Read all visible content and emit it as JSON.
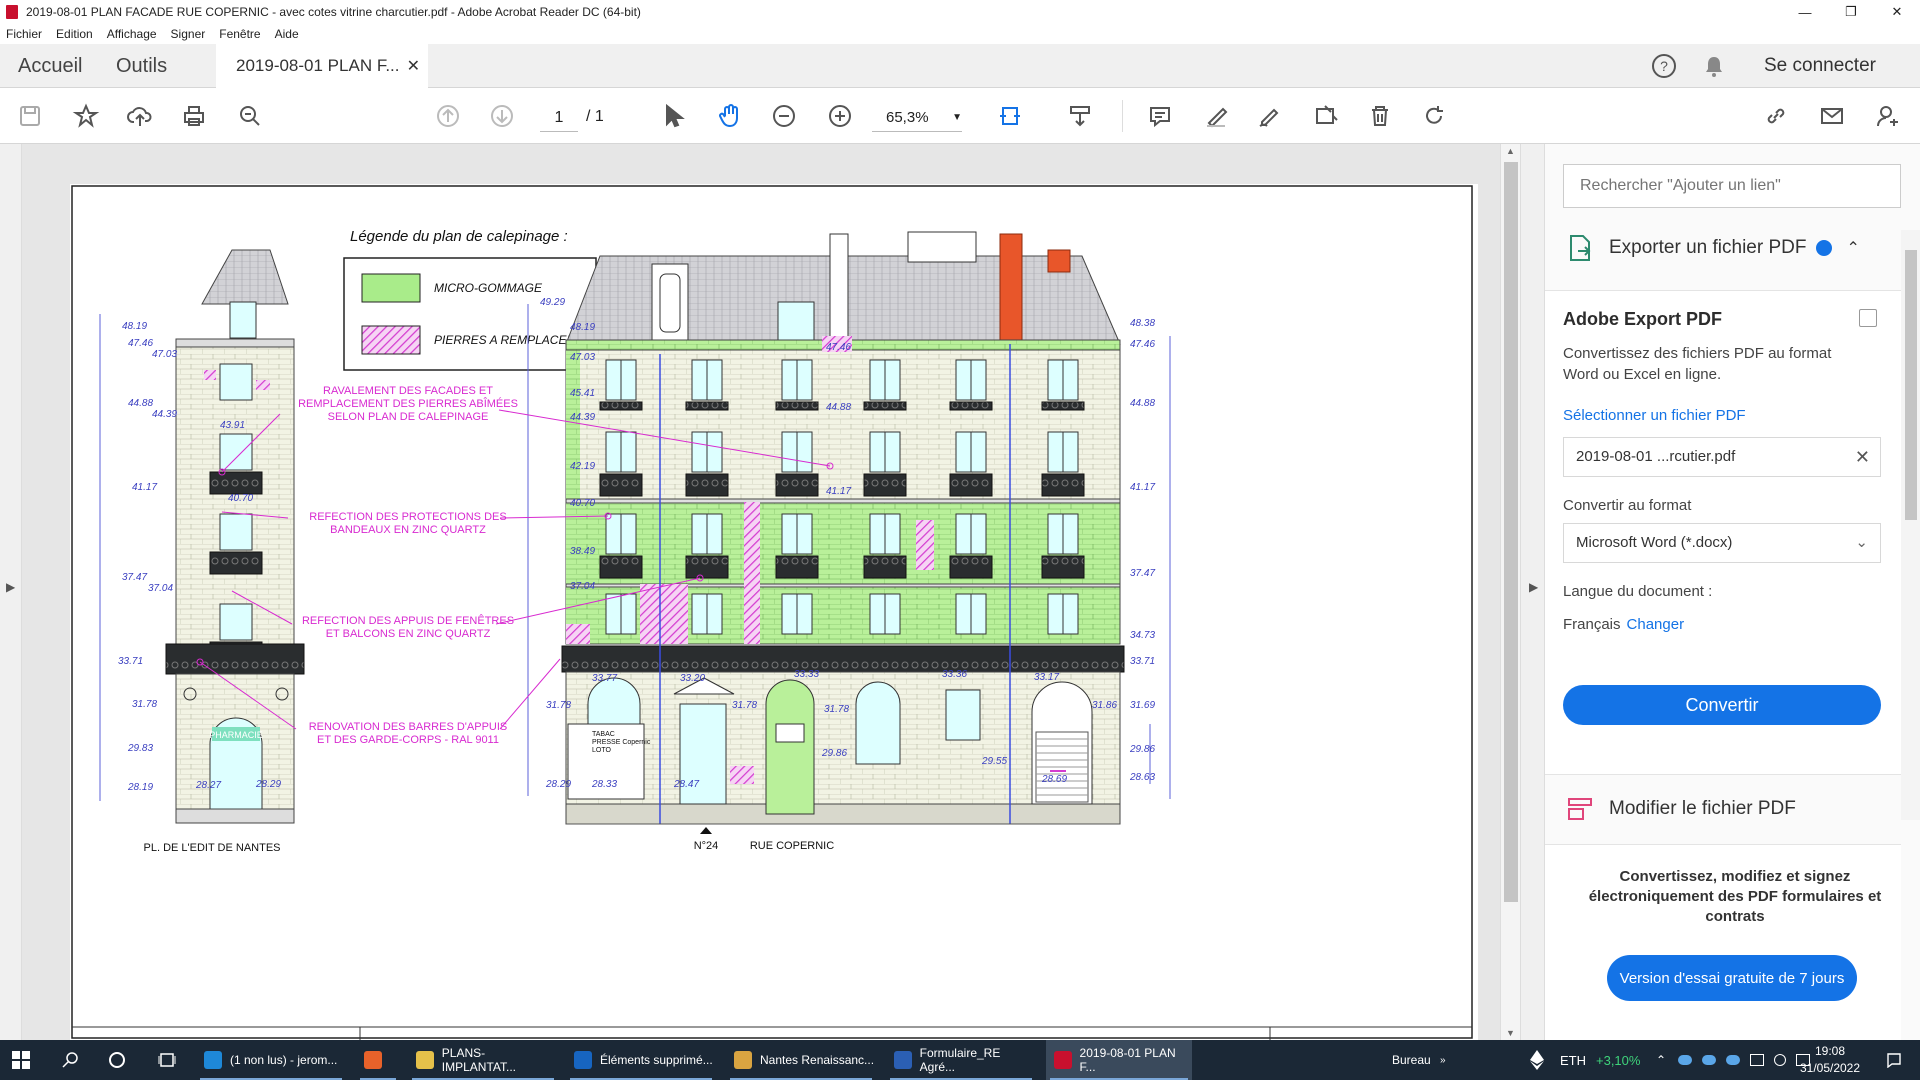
{
  "window": {
    "title": "2019-08-01 PLAN FACADE RUE COPERNIC - avec cotes vitrine charcutier.pdf - Adobe Acrobat Reader DC (64-bit)"
  },
  "menu": [
    "Fichier",
    "Edition",
    "Affichage",
    "Signer",
    "Fenêtre",
    "Aide"
  ],
  "tabs": {
    "home": "Accueil",
    "tools": "Outils",
    "doc": "2019-08-01 PLAN F...",
    "signin": "Se connecter"
  },
  "toolbar": {
    "page_current": "1",
    "page_total": "/ 1",
    "zoom": "65,3%"
  },
  "drawing": {
    "legend_title": "Légende du plan de calepinage :",
    "legend_items": [
      {
        "label": "MICRO-GOMMAGE",
        "color": "#a9ec8a"
      },
      {
        "label": "PIERRES A REMPLACER",
        "color": "#e47ae0"
      }
    ],
    "annotations": [
      "RAVALEMENT DES FACADES ET\nREMPLACEMENT DES PIERRES ABÎMÉES\nSELON PLAN DE CALEPINAGE",
      "REFECTION DES PROTECTIONS DES\nBANDEAUX EN ZINC QUARTZ",
      "REFECTION DES APPUIS DE FENÊTRES\nET BALCONS EN ZINC QUARTZ",
      "RENOVATION DES BARRES D'APPUIS\nET DES GARDE-CORPS - RAL 9011"
    ],
    "left_levels": [
      "48.19",
      "47.46",
      "47.03",
      "44.88",
      "44.39",
      "43.91",
      "41.17",
      "40.70",
      "37.47",
      "37.04",
      "33.71",
      "31.78",
      "29.83",
      "28.19",
      "28.27",
      "28.29"
    ],
    "right_levels": [
      "48.38",
      "47.46",
      "44.88",
      "41.17",
      "37.47",
      "34.73",
      "33.71",
      "31.69",
      "29.86",
      "28.63"
    ],
    "main_left_levels": [
      "49.29",
      "48.19",
      "47.03",
      "45.41",
      "44.39",
      "42.19",
      "40.70",
      "38.49",
      "37.04",
      "31.78",
      "28.29"
    ],
    "misc_levels": [
      "47.46",
      "44.88",
      "41.17",
      "33.77",
      "33.20",
      "33.33",
      "33.36",
      "33.17",
      "31.78",
      "31.78",
      "31.86",
      "29.86",
      "29.55",
      "28.33",
      "28.47",
      "28.69"
    ],
    "shop_sign": "PHARMACIE",
    "tabac_sign": "TABAC\nPRESSE Copernic\nLOTO",
    "caption_left": "PL. DE L'EDIT DE NANTES",
    "caption_num": "N°24",
    "caption_street": "RUE COPERNIC"
  },
  "right_panel": {
    "search_placeholder": "Rechercher \"Ajouter un lien\"",
    "export_title": "Exporter un fichier PDF",
    "box_header": "Adobe Export PDF",
    "box_desc": "Convertissez des fichiers PDF au format Word ou Excel en ligne.",
    "select_label": "Sélectionner un fichier PDF",
    "file_name": "2019-08-01 ...rcutier.pdf",
    "convert_to_label": "Convertir au format",
    "format_value": "Microsoft Word (*.docx)",
    "lang_label": "Langue du document :",
    "lang_value": "Français",
    "lang_change": "Changer",
    "convert_button": "Convertir",
    "modify_title": "Modifier le fichier PDF",
    "promo_text": "Convertissez, modifiez et signez électroniquement des PDF formulaires et contrats",
    "promo_button": "Version d'essai gratuite de 7 jours"
  },
  "taskbar": {
    "apps": [
      {
        "label": "(1 non lus) - jerom...",
        "color": "#1e88d8"
      },
      {
        "label": "",
        "color": "#e8622a"
      },
      {
        "label": "PLANS-IMPLANTAT...",
        "color": "#e6c14a"
      },
      {
        "label": "Éléments supprimé...",
        "color": "#1765c1"
      },
      {
        "label": "Nantes Renaissanc...",
        "color": "#d9a441"
      },
      {
        "label": "Formulaire_RE Agré...",
        "color": "#2b5fb4"
      },
      {
        "label": "2019-08-01 PLAN F...",
        "color": "#c8102e"
      }
    ],
    "desktop": "Bureau",
    "ticker": "ETH",
    "ticker_change": "+3,10%",
    "time": "19:08",
    "date": "31/05/2022"
  }
}
